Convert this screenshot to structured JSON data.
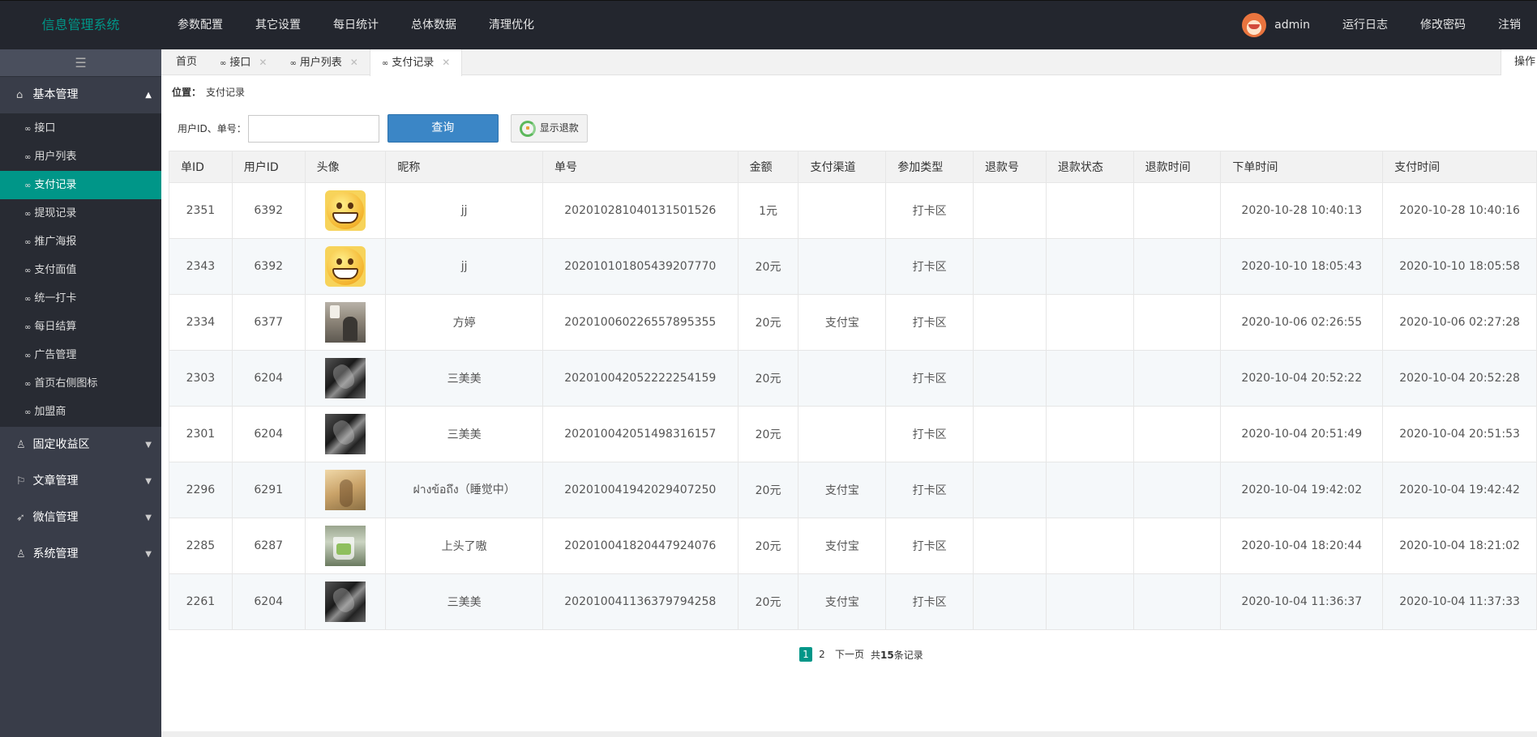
{
  "app": {
    "title": "信息管理系统"
  },
  "topnav": [
    "参数配置",
    "其它设置",
    "每日统计",
    "总体数据",
    "清理优化"
  ],
  "user": {
    "name": "admin"
  },
  "topright": {
    "log": "运行日志",
    "password": "修改密码",
    "logout": "注销"
  },
  "sidebar": {
    "toggle_icon": "☰",
    "groups": [
      {
        "label": "基本管理",
        "icon": "home-icon",
        "open": true
      },
      {
        "label": "固定收益区",
        "icon": "user-icon"
      },
      {
        "label": "文章管理",
        "icon": "flag-icon"
      },
      {
        "label": "微信管理",
        "icon": "send-icon"
      },
      {
        "label": "系统管理",
        "icon": "user-icon"
      }
    ],
    "items": [
      "接口",
      "用户列表",
      "支付记录",
      "提现记录",
      "推广海报",
      "支付面值",
      "统一打卡",
      "每日结算",
      "广告管理",
      "首页右侧图标",
      "加盟商"
    ],
    "active_item": "支付记录"
  },
  "tabs": [
    {
      "label": "首页"
    },
    {
      "label": "接口"
    },
    {
      "label": "用户列表"
    },
    {
      "label": "支付记录",
      "active": true
    }
  ],
  "ops_label": "操作",
  "location": {
    "label": "位置：",
    "value": "支付记录"
  },
  "filter": {
    "label": "用户ID、单号：",
    "value": "",
    "query_label": "查询",
    "refund_label": "显示退款"
  },
  "table": {
    "columns": [
      "单ID",
      "用户ID",
      "头像",
      "昵称",
      "单号",
      "金额",
      "支付渠道",
      "参加类型",
      "退款号",
      "退款状态",
      "退款时间",
      "下单时间",
      "支付时间"
    ],
    "rows": [
      {
        "id": "2351",
        "uid": "6392",
        "avatar": "grin",
        "nick": "jj",
        "order": "20201028104013150152​6",
        "amount": "1元",
        "channel": "",
        "type": "打卡区",
        "refund_no": "",
        "refund_status": "",
        "refund_time": "",
        "created": "2020-10-28 10:40:13",
        "paid": "2020-10-28 10:40:16"
      },
      {
        "id": "2343",
        "uid": "6392",
        "avatar": "grin",
        "nick": "jj",
        "order": "20201010180543920777​0",
        "amount": "20元",
        "channel": "",
        "type": "打卡区",
        "refund_no": "",
        "refund_status": "",
        "refund_time": "",
        "created": "2020-10-10 18:05:43",
        "paid": "2020-10-10 18:05:58"
      },
      {
        "id": "2334",
        "uid": "6377",
        "avatar": "lamp",
        "nick": "方婷",
        "order": "20201006022655789535​5",
        "amount": "20元",
        "channel": "支付宝",
        "type": "打卡区",
        "refund_no": "",
        "refund_status": "",
        "refund_time": "",
        "created": "2020-10-06 02:26:55",
        "paid": "2020-10-06 02:27:28"
      },
      {
        "id": "2303",
        "uid": "6204",
        "avatar": "dark",
        "nick": "三美美",
        "order": "20201004205222225415​9",
        "amount": "20元",
        "channel": "",
        "type": "打卡区",
        "refund_no": "",
        "refund_status": "",
        "refund_time": "",
        "created": "2020-10-04 20:52:22",
        "paid": "2020-10-04 20:52:28"
      },
      {
        "id": "2301",
        "uid": "6204",
        "avatar": "dark",
        "nick": "三美美",
        "order": "20201004205149831615​7",
        "amount": "20元",
        "channel": "",
        "type": "打卡区",
        "refund_no": "",
        "refund_status": "",
        "refund_time": "",
        "created": "2020-10-04 20:51:49",
        "paid": "2020-10-04 20:51:53"
      },
      {
        "id": "2296",
        "uid": "6291",
        "avatar": "warm",
        "nick": "ฝางข้อถึง（睡觉中）",
        "order": "20201004194202940725​0",
        "amount": "20元",
        "channel": "支付宝",
        "type": "打卡区",
        "refund_no": "",
        "refund_status": "",
        "refund_time": "",
        "created": "2020-10-04 19:42:02",
        "paid": "2020-10-04 19:42:42"
      },
      {
        "id": "2285",
        "uid": "6287",
        "avatar": "cup",
        "nick": "上头了嗷",
        "order": "20201004182044792407​6",
        "amount": "20元",
        "channel": "支付宝",
        "type": "打卡区",
        "refund_no": "",
        "refund_status": "",
        "refund_time": "",
        "created": "2020-10-04 18:20:44",
        "paid": "2020-10-04 18:21:02"
      },
      {
        "id": "2261",
        "uid": "6204",
        "avatar": "dark",
        "nick": "三美美",
        "order": "20201004113637979425​8",
        "amount": "20元",
        "channel": "支付宝",
        "type": "打卡区",
        "refund_no": "",
        "refund_status": "",
        "refund_time": "",
        "created": "2020-10-04 11:36:37",
        "paid": "2020-10-04 11:37:33"
      }
    ]
  },
  "pager": {
    "current": "1",
    "page2": "2",
    "next": "下一页",
    "total_prefix": "共",
    "total_count": "15",
    "total_suffix": "条记录"
  },
  "colors": {
    "accent": "#009688",
    "topbar": "#23262e",
    "sidebar": "#393d49",
    "query_button": "#3b86c6"
  }
}
